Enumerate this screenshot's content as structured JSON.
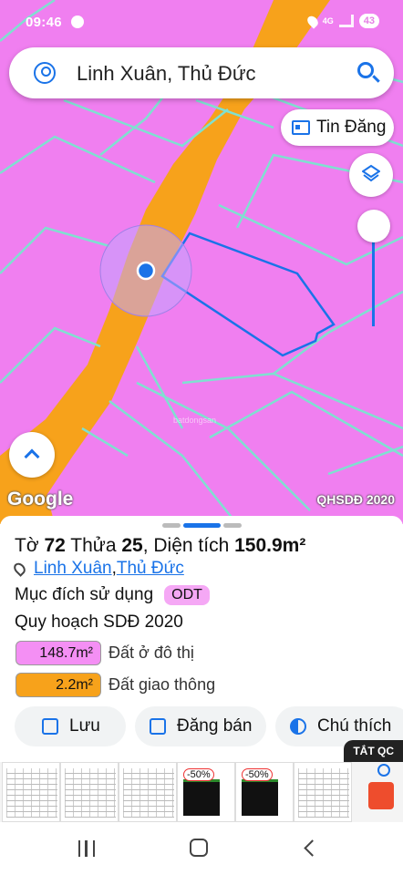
{
  "status_bar": {
    "time": "09:46",
    "network": "4G",
    "battery": "43",
    "icons": [
      "messenger-icon",
      "location-icon",
      "signal-icon",
      "battery-icon"
    ]
  },
  "search": {
    "query": "Linh Xuân, Thủ Đức",
    "icons": [
      "user-icon",
      "search-icon"
    ]
  },
  "map": {
    "tin_dang_label": "Tin Đăng",
    "logo": "Google",
    "layer_label": "QHSDĐ 2020",
    "watermark": "batdongsan",
    "colors": {
      "residential": "#f07ff0",
      "road": "#f7a21b",
      "boundary": "#7fe0d0",
      "selection": "#1a73e8"
    }
  },
  "parcel": {
    "sheet_prefix": "Tờ ",
    "sheet_no": "72",
    "lot_prefix": " Thửa ",
    "lot_no": "25",
    "area_prefix": ", Diện tích ",
    "area": "150.9m²",
    "ward": "Linh Xuân",
    "separator": ", ",
    "district": "Thủ Đức",
    "purpose_label": "Mục đích sử dụng",
    "purpose_code": "ODT",
    "plan_title": "Quy hoạch SDĐ 2020",
    "zones": [
      {
        "area": "148.7m²",
        "label": "Đất ở đô thị",
        "color": "#f48ff4"
      },
      {
        "area": "2.2m²",
        "label": "Đất giao thông",
        "color": "#f7a21b"
      }
    ]
  },
  "actions": {
    "save": "Lưu",
    "post_sale": "Đăng bán",
    "legend": "Chú thích"
  },
  "ad": {
    "close_label": "TẮT QC",
    "discount_1": "-50%",
    "discount_2": "-50%"
  }
}
